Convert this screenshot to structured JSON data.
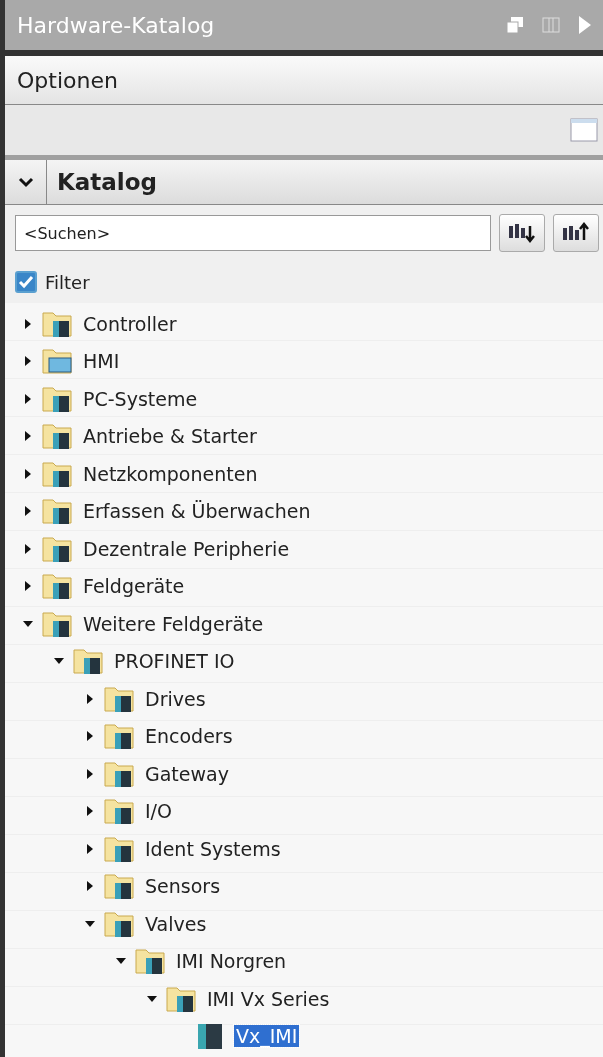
{
  "window": {
    "title": "Hardware-Katalog"
  },
  "options": {
    "title": "Optionen"
  },
  "catalog": {
    "title": "Katalog",
    "expanded": true
  },
  "search": {
    "placeholder": "<Suchen>"
  },
  "filter": {
    "label": "Filter",
    "checked": true
  },
  "tree": [
    {
      "label": "Controller",
      "kind": "folder",
      "expanded": false,
      "selected": false
    },
    {
      "label": "HMI",
      "kind": "screen-folder",
      "expanded": false,
      "selected": false
    },
    {
      "label": "PC-Systeme",
      "kind": "folder",
      "expanded": false,
      "selected": false
    },
    {
      "label": "Antriebe & Starter",
      "kind": "folder",
      "expanded": false,
      "selected": false
    },
    {
      "label": "Netzkomponenten",
      "kind": "folder",
      "expanded": false,
      "selected": false
    },
    {
      "label": "Erfassen & Überwachen",
      "kind": "folder",
      "expanded": false,
      "selected": false
    },
    {
      "label": "Dezentrale Peripherie",
      "kind": "folder",
      "expanded": false,
      "selected": false
    },
    {
      "label": "Feldgeräte",
      "kind": "folder",
      "expanded": false,
      "selected": false
    },
    {
      "label": "Weitere Feldgeräte",
      "kind": "folder",
      "expanded": true,
      "selected": false,
      "children": [
        {
          "label": "PROFINET IO",
          "kind": "folder",
          "expanded": true,
          "selected": false,
          "children": [
            {
              "label": "Drives",
              "kind": "folder",
              "expanded": false,
              "selected": false
            },
            {
              "label": "Encoders",
              "kind": "folder",
              "expanded": false,
              "selected": false
            },
            {
              "label": "Gateway",
              "kind": "folder",
              "expanded": false,
              "selected": false
            },
            {
              "label": "I/O",
              "kind": "folder",
              "expanded": false,
              "selected": false
            },
            {
              "label": "Ident Systems",
              "kind": "folder",
              "expanded": false,
              "selected": false
            },
            {
              "label": "Sensors",
              "kind": "folder",
              "expanded": false,
              "selected": false
            },
            {
              "label": "Valves",
              "kind": "folder",
              "expanded": true,
              "selected": false,
              "children": [
                {
                  "label": "IMI Norgren",
                  "kind": "folder",
                  "expanded": true,
                  "selected": false,
                  "children": [
                    {
                      "label": "IMI Vx Series",
                      "kind": "folder",
                      "expanded": true,
                      "selected": false,
                      "children": [
                        {
                          "label": "Vx_IMI",
                          "kind": "device",
                          "selected": true
                        }
                      ]
                    }
                  ]
                }
              ]
            }
          ]
        }
      ]
    }
  ]
}
